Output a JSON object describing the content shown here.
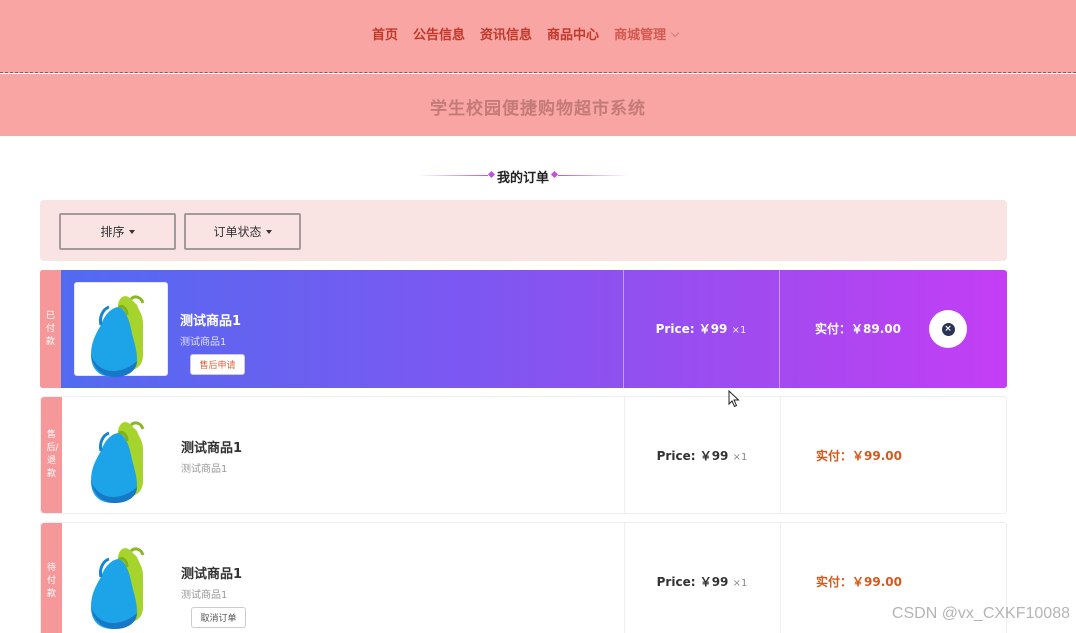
{
  "nav": {
    "items": [
      "首页",
      "公告信息",
      "资讯信息",
      "商品中心"
    ],
    "more_label": "商城管理"
  },
  "site_title": "学生校园便捷购物超市系统",
  "section_title": "我的订单",
  "filters": {
    "sort_label": "排序",
    "status_label": "订单状态"
  },
  "orders": [
    {
      "status": "已付款",
      "name": "测试商品1",
      "sub": "测试商品1",
      "price": "Price: ￥99",
      "qty": "×1",
      "paid": "实付：￥89.00",
      "button": "售后申请"
    },
    {
      "status": "售后/退款",
      "name": "测试商品1",
      "sub": "测试商品1",
      "price": "Price: ￥99",
      "qty": "×1",
      "paid": "实付：￥99.00"
    },
    {
      "status": "待付款",
      "name": "测试商品1",
      "sub": "测试商品1",
      "price": "Price: ￥99",
      "qty": "×1",
      "paid": "实付：￥99.00",
      "button": "取消订单"
    }
  ],
  "watermark": "CSDN @vx_CXKF10088",
  "colors": {
    "nav_bg": "#f9a5a3",
    "accent_purple": "#c43ef5",
    "accent_blue": "#4f6cf0",
    "paid_text": "#d35a1a",
    "status_strip": "#f6989a"
  }
}
